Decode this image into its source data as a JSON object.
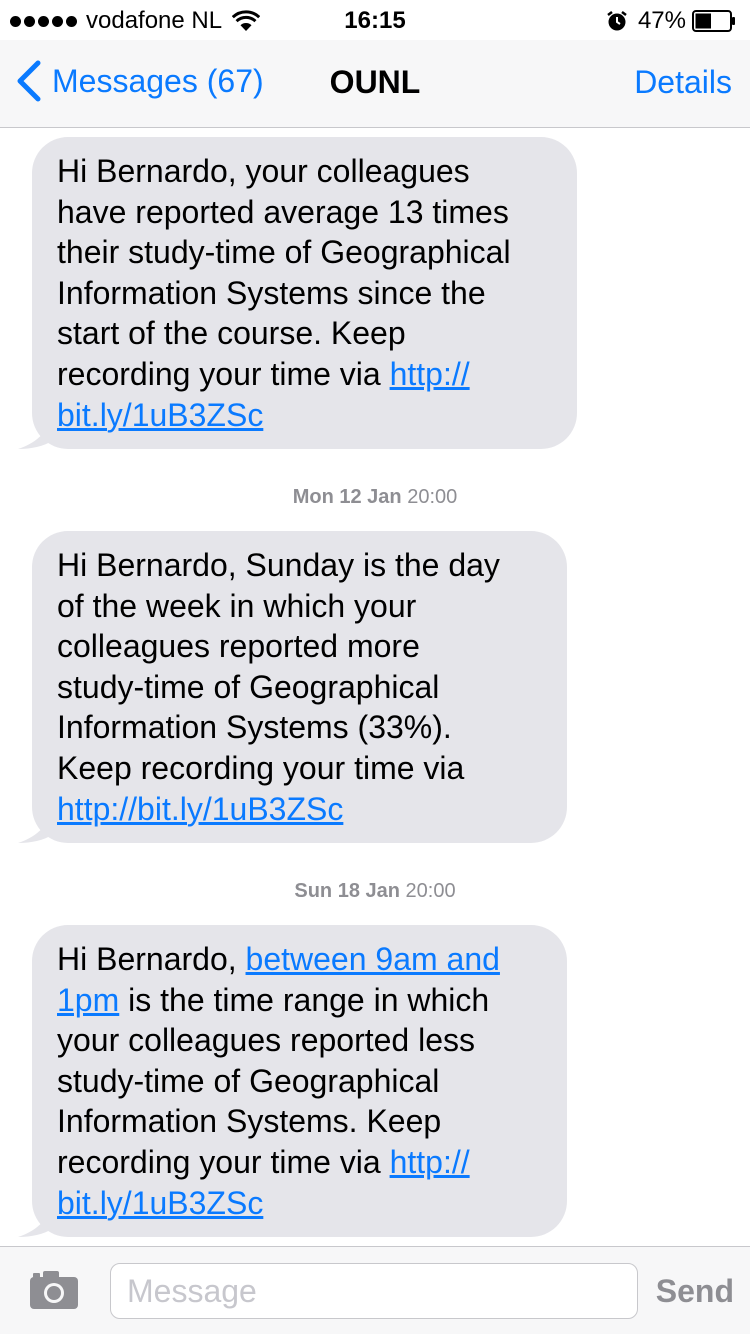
{
  "status_bar": {
    "carrier": "vodafone NL",
    "time": "16:15",
    "battery_percent": "47%",
    "battery_level": 0.47,
    "icons": [
      "signal-dots",
      "wifi-icon",
      "alarm-icon",
      "battery-icon"
    ]
  },
  "nav": {
    "back_label": "Messages (67)",
    "title": "OUNL",
    "details_label": "Details"
  },
  "messages": [
    {
      "lines": [
        {
          "text": "Hi Bernardo, your colleagues"
        },
        {
          "text": "have reported average 13 times"
        },
        {
          "text": "their study-time of Geographical"
        },
        {
          "text": "Information Systems since the"
        },
        {
          "text": "start of the course. Keep"
        },
        {
          "pre": "recording your time via ",
          "link": "http://"
        },
        {
          "link": "bit.ly/1uB3ZSc"
        }
      ]
    },
    {
      "timestamp": {
        "day": "Mon 12 Jan",
        "time": "20:00"
      },
      "lines": [
        {
          "text": "Hi Bernardo, Sunday is the day"
        },
        {
          "text": "of the week in which your"
        },
        {
          "text": "colleagues reported more"
        },
        {
          "text": "study-time of Geographical"
        },
        {
          "text": "Information Systems (33%)."
        },
        {
          "text": "Keep recording your time via"
        },
        {
          "link": "http://bit.ly/1uB3ZSc"
        }
      ]
    },
    {
      "timestamp": {
        "day": "Sun 18 Jan",
        "time": "20:00"
      },
      "lines": [
        {
          "pre": "Hi Bernardo, ",
          "link": "between 9am and"
        },
        {
          "link": "1pm",
          "post": " is the time range in which"
        },
        {
          "text": "your colleagues reported less"
        },
        {
          "text": "study-time of Geographical"
        },
        {
          "text": "Information Systems. Keep"
        },
        {
          "pre": "recording your time via ",
          "link": "http://"
        },
        {
          "link": "bit.ly/1uB3ZSc"
        }
      ]
    }
  ],
  "input_bar": {
    "placeholder": "Message",
    "value": "",
    "send_label": "Send"
  },
  "colors": {
    "accent": "#0a7aff",
    "bubble": "#e5e5ea",
    "bar_background": "#f7f7f8",
    "timestamp": "#8e8e93"
  }
}
